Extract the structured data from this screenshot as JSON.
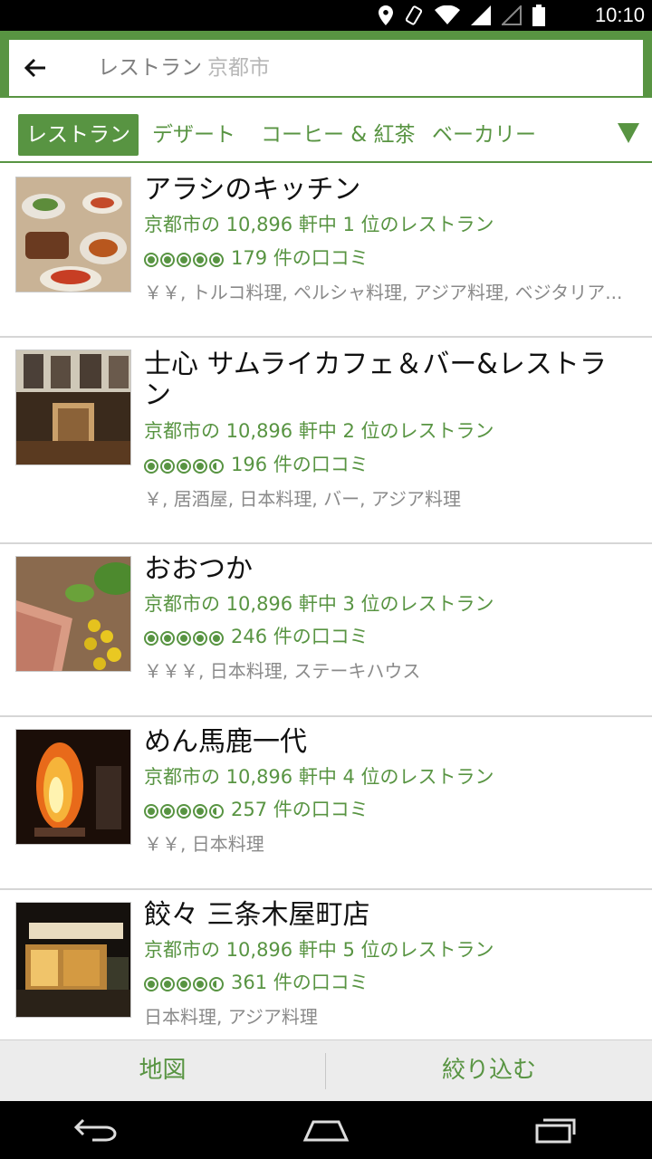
{
  "status": {
    "time": "10:10"
  },
  "search": {
    "query": "レストラン",
    "location": "京都市"
  },
  "tabs": [
    "レストラン",
    "デザート",
    "コーヒー & 紅茶",
    "ベーカリー"
  ],
  "restaurants": [
    {
      "name": "アラシのキッチン",
      "rank": "京都市の 10,896 軒中 1 位のレストラン",
      "rating": 5,
      "reviews": "179 件の口コミ",
      "tags": "￥￥, トルコ料理, ペルシャ料理, アジア料理, ベジタリア..."
    },
    {
      "name": "士心 サムライカフェ＆バー&レストラン",
      "rank": "京都市の 10,896 軒中 2 位のレストラン",
      "rating": 4.5,
      "reviews": "196 件の口コミ",
      "tags": "￥, 居酒屋, 日本料理, バー, アジア料理"
    },
    {
      "name": "おおつか",
      "rank": "京都市の 10,896 軒中 3 位のレストラン",
      "rating": 5,
      "reviews": "246 件の口コミ",
      "tags": "￥￥￥, 日本料理, ステーキハウス"
    },
    {
      "name": "めん馬鹿一代",
      "rank": "京都市の 10,896 軒中 4 位のレストラン",
      "rating": 4.5,
      "reviews": "257 件の口コミ",
      "tags": "￥￥, 日本料理"
    },
    {
      "name": "餃々 三条木屋町店",
      "rank": "京都市の 10,896 軒中 5 位のレストラン",
      "rating": 4.5,
      "reviews": "361 件の口コミ",
      "tags": "日本料理, アジア料理"
    }
  ],
  "actions": {
    "map": "地図",
    "filter": "絞り込む"
  },
  "colors": {
    "accent": "#589442"
  }
}
